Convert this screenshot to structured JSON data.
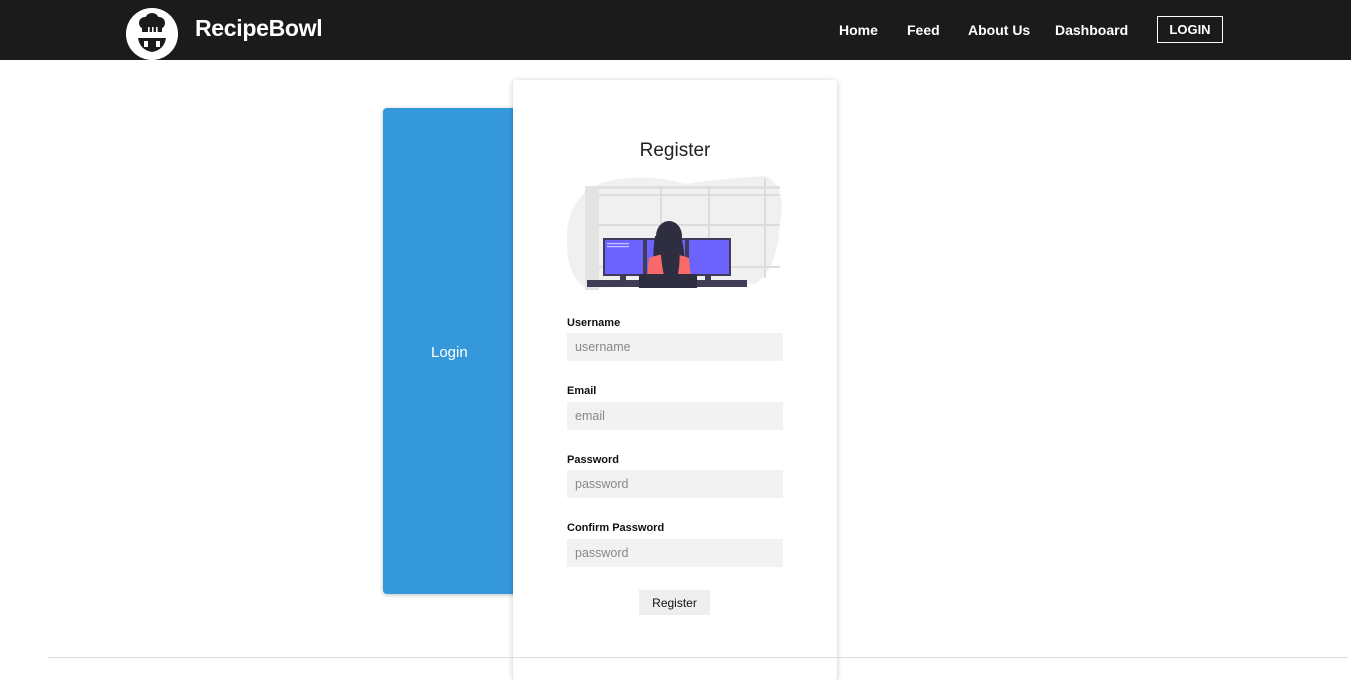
{
  "navbar": {
    "brand": "RecipeBowl",
    "links": [
      "Home",
      "Feed",
      "About Us",
      "Dashboard"
    ],
    "login_label": "LOGIN"
  },
  "login_panel": {
    "label": "Login"
  },
  "register": {
    "title": "Register",
    "fields": [
      {
        "label": "Username",
        "placeholder": "username"
      },
      {
        "label": "Email",
        "placeholder": "email"
      },
      {
        "label": "Password",
        "placeholder": "password"
      },
      {
        "label": "Confirm Password",
        "placeholder": "password"
      }
    ],
    "submit_label": "Register"
  },
  "colors": {
    "navbar_bg": "#1b1b1b",
    "accent_blue": "#3498db",
    "monitor_purple": "#6c63ff",
    "person_pink": "#f86a6a"
  }
}
